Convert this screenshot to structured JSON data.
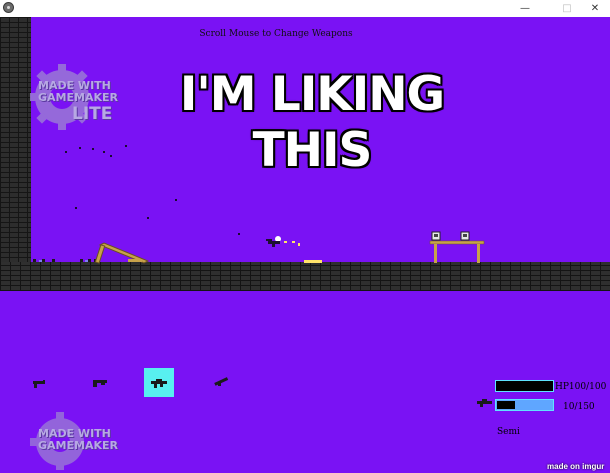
{
  "window": {
    "app_icon": "gear-icon",
    "buttons": {
      "minimize": "—",
      "maximize": "□",
      "close": "✕"
    }
  },
  "hud": {
    "hint": "Scroll Mouse to Change Weapons",
    "hp_label": "HP100/100",
    "hp_fraction": 1.0,
    "ammo_label": "10/150",
    "ammo_fraction": 0.33,
    "weapon_name": "Semi"
  },
  "overlay": {
    "meme_caption": "I'M LIKING THIS",
    "credit": "made on imgur"
  },
  "logos": {
    "top": {
      "line1": "MADE WITH",
      "line2": "GAMEMAKER",
      "line3": "LITE"
    },
    "bottom": {
      "line1": "MADE WITH",
      "line2": "GAMEMAKER"
    }
  },
  "weapons": [
    {
      "name": "pistol-icon",
      "selected": false
    },
    {
      "name": "shotgun-icon",
      "selected": false
    },
    {
      "name": "semi-rifle-icon",
      "selected": true
    },
    {
      "name": "launcher-icon",
      "selected": false
    }
  ],
  "colors": {
    "sky": "#7a12f4",
    "brick": "#2f2f2f",
    "selected_slot": "#58f0f0",
    "bar_border": "#5fe3ff",
    "ammo_fill": "#5fa6ff",
    "table": "#c8a24a"
  }
}
